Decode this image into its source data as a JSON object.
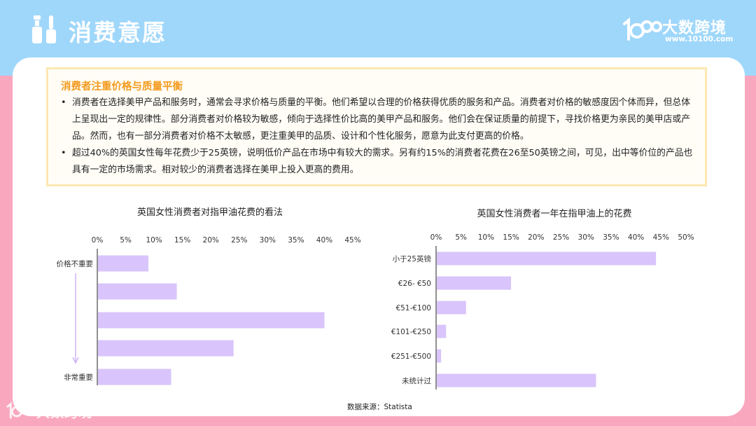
{
  "header": {
    "title": "消费意愿",
    "brand_name": "大数跨境",
    "brand_url": "www.10100.com",
    "icon": "nail-polish-icon",
    "brand_icon": "10100-logo-icon"
  },
  "summary": {
    "heading": "消费者注重价格与质量平衡",
    "bullets": [
      "消费者在选择美甲产品和服务时，通常会寻求价格与质量的平衡。他们希望以合理的价格获得优质的服务和产品。消费者对价格的敏感度因个体而异，但总体上呈现出一定的规律性。部分消费者对价格较为敏感，倾向于选择性价比高的美甲产品和服务。他们会在保证质量的前提下，寻找价格更为亲民的美甲店或产品。然而，也有一部分消费者对价格不太敏感，更注重美甲的品质、设计和个性化服务，愿意为此支付更高的价格。",
      "超过40%的英国女性每年花费少于25英镑，说明低价产品在市场中有较大的需求。另有约15%的消费者花费在26至50英镑之间，可见，出中等价位的产品也具有一定的市场需求。相对较少的消费者选择在美甲上投入更高的费用。"
    ],
    "bullet_char": "•"
  },
  "colors": {
    "bar": "#d9c4fb",
    "heading": "#f39a1d",
    "top_band": "#9fd7fb",
    "bottom_band": "#f9a7bf"
  },
  "chart_data": [
    {
      "type": "bar",
      "orientation": "horizontal",
      "title": "英国女性消费者对指甲油花费的看法",
      "categories": [
        "价格不重要",
        "",
        "",
        "",
        "非常重要"
      ],
      "values": [
        9,
        14,
        40,
        24,
        13
      ],
      "unit": "%",
      "xlim": [
        0,
        45
      ],
      "xticks": [
        "0%",
        "5%",
        "10%",
        "15%",
        "20%",
        "25%",
        "30%",
        "35%",
        "40%",
        "45%"
      ],
      "axis_position": "top",
      "grid": false
    },
    {
      "type": "bar",
      "orientation": "horizontal",
      "title": "英国女性消费者一年在指甲油上的花费",
      "categories": [
        "小于25英镑",
        "€26- €50",
        "€51-€100",
        "€101-€250",
        "€251-€500",
        "未统计过"
      ],
      "values": [
        44,
        15,
        6,
        2,
        1,
        32
      ],
      "unit": "%",
      "xlim": [
        0,
        50
      ],
      "xticks": [
        "0%",
        "5%",
        "10%",
        "15%",
        "20%",
        "25%",
        "30%",
        "35%",
        "40%",
        "45%",
        "50%"
      ],
      "axis_position": "top",
      "grid": false
    }
  ],
  "footer": {
    "source": "数据来源：Statista",
    "watermark": "大数跨境"
  }
}
